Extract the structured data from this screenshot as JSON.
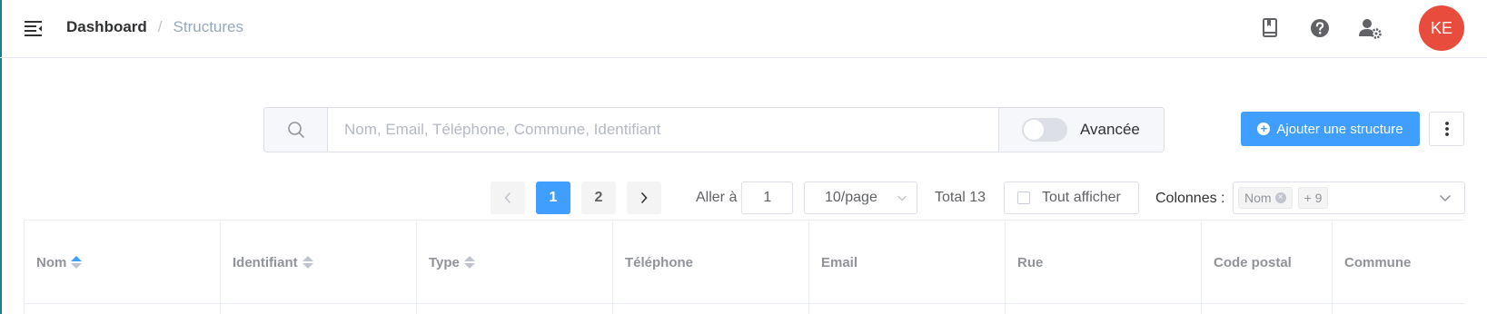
{
  "header": {
    "breadcrumb": {
      "root": "Dashboard",
      "separator": "/",
      "current": "Structures"
    },
    "icons": [
      "book-icon",
      "help-icon",
      "user-settings-icon"
    ],
    "avatar": "KE",
    "avatar_color": "#e84c3d"
  },
  "search": {
    "placeholder": "Nom, Email, Téléphone, Commune, Identifiant",
    "value": "",
    "advanced_label": "Avancée",
    "advanced_on": false
  },
  "actions": {
    "add_label": "Ajouter une structure",
    "accent_color": "#409eff"
  },
  "pagination": {
    "pages": [
      "1",
      "2"
    ],
    "current_page": "1",
    "goto_label": "Aller à",
    "goto_value": "1",
    "page_size": "10/page",
    "total": "Total 13",
    "show_all_label": "Tout afficher"
  },
  "columns_filter": {
    "label": "Colonnes :",
    "tags": [
      "Nom",
      "+ 9"
    ]
  },
  "table": {
    "headers": [
      {
        "label": "Nom",
        "sortable": true,
        "sort": "asc"
      },
      {
        "label": "Identifiant",
        "sortable": true,
        "sort": ""
      },
      {
        "label": "Type",
        "sortable": true,
        "sort": ""
      },
      {
        "label": "Téléphone",
        "sortable": false,
        "sort": ""
      },
      {
        "label": "Email",
        "sortable": false,
        "sort": ""
      },
      {
        "label": "Rue",
        "sortable": false,
        "sort": ""
      },
      {
        "label": "Code postal",
        "sortable": false,
        "sort": ""
      },
      {
        "label": "Commune",
        "sortable": false,
        "sort": ""
      }
    ]
  }
}
